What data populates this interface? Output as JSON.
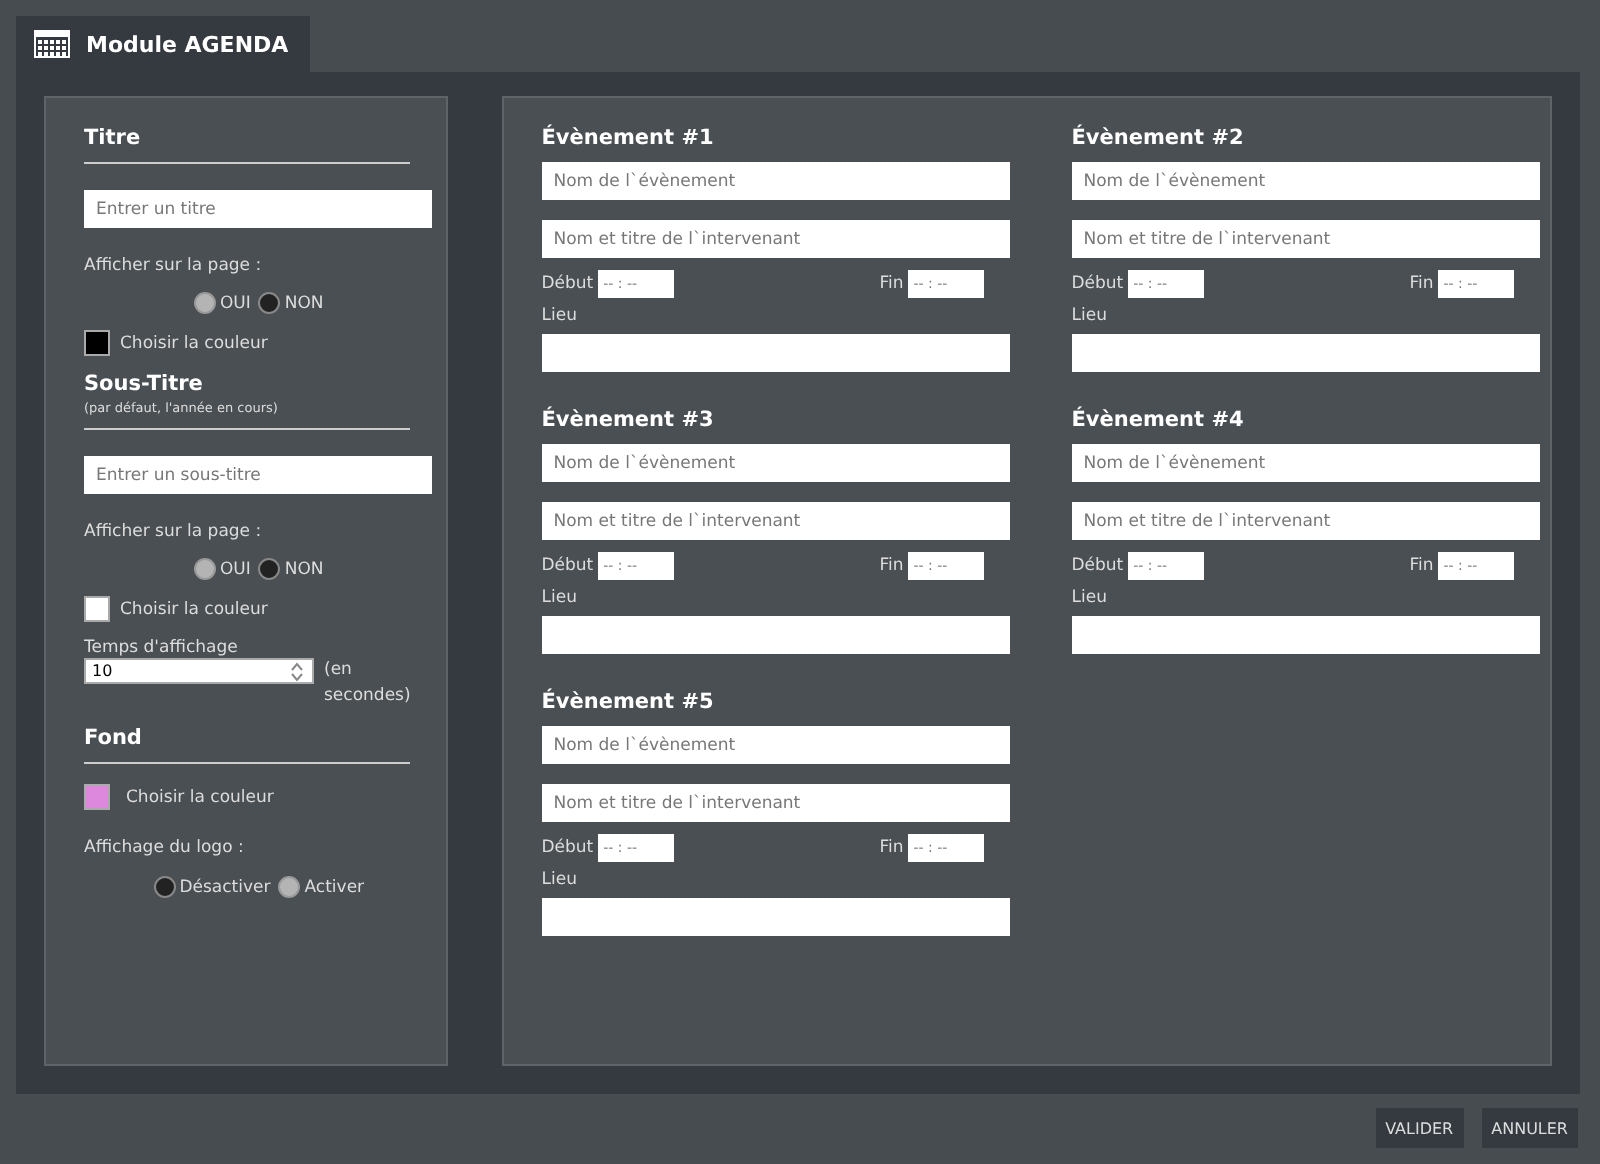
{
  "tab": {
    "title": "Module AGENDA",
    "selected": true
  },
  "settings": {
    "title_section": {
      "heading": "Titre",
      "placeholder": "Entrer un titre",
      "display_label": "Afficher sur la page :",
      "options": [
        {
          "label": "OUI",
          "selected": true
        },
        {
          "label": "NON",
          "selected": false
        }
      ],
      "color_label": "Choisir la couleur",
      "color": "#000000"
    },
    "subtitle_section": {
      "heading": "Sous-Titre",
      "hint": "(par défaut, l'année en cours)",
      "placeholder": "Entrer un sous-titre",
      "display_label": "Afficher sur la page :",
      "options": [
        {
          "label": "OUI",
          "selected": true
        },
        {
          "label": "NON",
          "selected": false
        }
      ],
      "color_label": "Choisir la couleur",
      "color": "#ffffff",
      "duration_label": "Temps d'affichage",
      "duration_value": "10",
      "duration_unit": "(en secondes)"
    },
    "background_section": {
      "heading": "Fond",
      "color_label": "Choisir la couleur",
      "color": "#dd88dd",
      "logo_label": "Affichage du logo :",
      "options": [
        {
          "label": "Désactiver",
          "selected": false
        },
        {
          "label": "Activer",
          "selected": true
        }
      ]
    }
  },
  "events": [
    {
      "title": "Évènement #1",
      "name_placeholder": "Nom de l`évènement",
      "speaker_placeholder": "Nom et titre de l`intervenant",
      "start_label": "Début",
      "start_placeholder": "-- : --",
      "end_label": "Fin",
      "end_placeholder": "-- : --",
      "place_label": "Lieu"
    },
    {
      "title": "Évènement #2",
      "name_placeholder": "Nom de l`évènement",
      "speaker_placeholder": "Nom et titre de l`intervenant",
      "start_label": "Début",
      "start_placeholder": "-- : --",
      "end_label": "Fin",
      "end_placeholder": "-- : --",
      "place_label": "Lieu"
    },
    {
      "title": "Évènement #3",
      "name_placeholder": "Nom de l`évènement",
      "speaker_placeholder": "Nom et titre de l`intervenant",
      "start_label": "Début",
      "start_placeholder": "-- : --",
      "end_label": "Fin",
      "end_placeholder": "-- : --",
      "place_label": "Lieu"
    },
    {
      "title": "Évènement #4",
      "name_placeholder": "Nom de l`évènement",
      "speaker_placeholder": "Nom et titre de l`intervenant",
      "start_label": "Début",
      "start_placeholder": "-- : --",
      "end_label": "Fin",
      "end_placeholder": "-- : --",
      "place_label": "Lieu"
    },
    {
      "title": "Évènement #5",
      "name_placeholder": "Nom de l`évènement",
      "speaker_placeholder": "Nom et titre de l`intervenant",
      "start_label": "Début",
      "start_placeholder": "-- : --",
      "end_label": "Fin",
      "end_placeholder": "-- : --",
      "place_label": "Lieu"
    }
  ],
  "buttons": [
    "VALIDER",
    "ANNULER"
  ]
}
